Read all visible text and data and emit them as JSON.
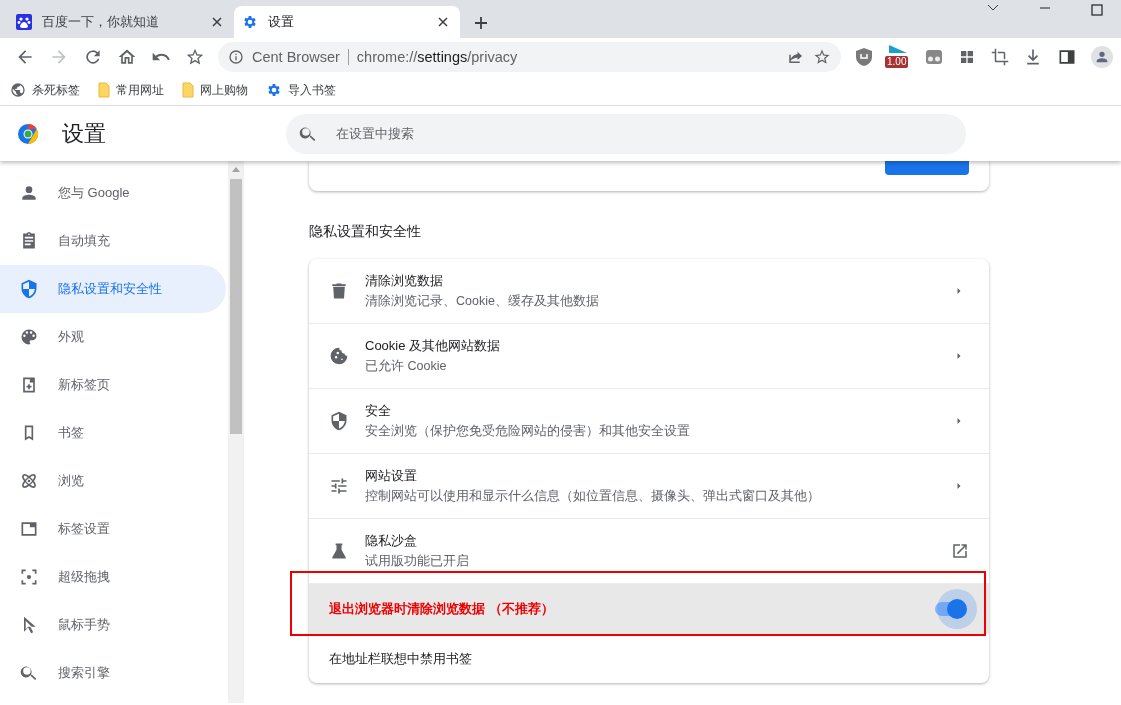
{
  "tabs": [
    {
      "title": "百度一下，你就知道",
      "selected": false
    },
    {
      "title": "设置",
      "selected": true
    }
  ],
  "address_bar": {
    "site": "Cent Browser",
    "url": [
      "chrome://",
      "settings",
      "/privacy"
    ]
  },
  "extension_badge": "1.00",
  "bookmarks": [
    {
      "label": "杀死标签"
    },
    {
      "label": "常用网址"
    },
    {
      "label": "网上购物"
    },
    {
      "label": "导入书签"
    }
  ],
  "settings": {
    "title": "设置",
    "search_placeholder": "在设置中搜索"
  },
  "sidebar": {
    "items": [
      {
        "label": "您与 Google",
        "selected": false
      },
      {
        "label": "自动填充",
        "selected": false
      },
      {
        "label": "隐私设置和安全性",
        "selected": true
      },
      {
        "label": "外观",
        "selected": false
      },
      {
        "label": "新标签页",
        "selected": false
      },
      {
        "label": "书签",
        "selected": false
      },
      {
        "label": "浏览",
        "selected": false
      },
      {
        "label": "标签设置",
        "selected": false
      },
      {
        "label": "超级拖拽",
        "selected": false
      },
      {
        "label": "鼠标手势",
        "selected": false
      },
      {
        "label": "搜索引擎",
        "selected": false
      }
    ]
  },
  "section_title": "隐私设置和安全性",
  "rows": [
    {
      "kind": "link",
      "title": "清除浏览数据",
      "subtitle": "清除浏览记录、Cookie、缓存及其他数据"
    },
    {
      "kind": "link",
      "title": "Cookie 及其他网站数据",
      "subtitle": "已允许 Cookie"
    },
    {
      "kind": "link",
      "title": "安全",
      "subtitle": "安全浏览（保护您免受危险网站的侵害）和其他安全设置"
    },
    {
      "kind": "link",
      "title": "网站设置",
      "subtitle": "控制网站可以使用和显示什么信息（如位置信息、摄像头、弹出式窗口及其他）"
    },
    {
      "kind": "external",
      "title": "隐私沙盒",
      "subtitle": "试用版功能已开启"
    },
    {
      "kind": "toggle",
      "title": "退出浏览器时清除浏览数据 （不推荐）",
      "on": true,
      "highlighted": true
    },
    {
      "kind": "plain",
      "title": "在地址栏联想中禁用书签",
      "highlighted": false
    }
  ]
}
